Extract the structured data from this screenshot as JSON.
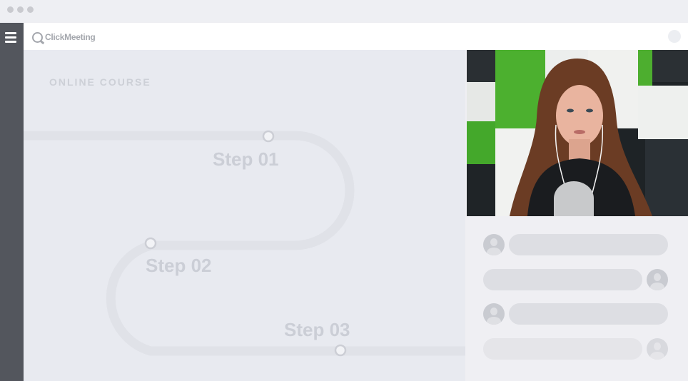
{
  "window": {
    "title_dots": 3
  },
  "app": {
    "logo_text": "ClickMeeting"
  },
  "course": {
    "label": "ONLINE COURSE",
    "steps": [
      {
        "label": "Step 01"
      },
      {
        "label": "Step 02"
      },
      {
        "label": "Step 03"
      }
    ]
  },
  "video": {
    "icon": "presenter-video"
  },
  "chat": {
    "message_count": 4
  }
}
